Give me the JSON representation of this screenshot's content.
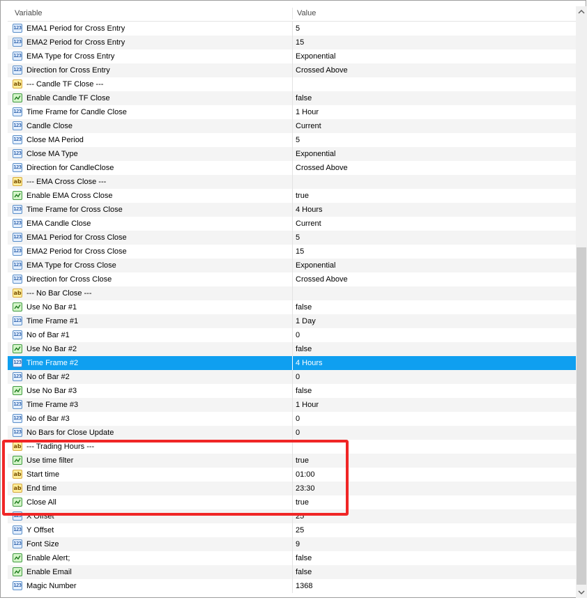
{
  "header": {
    "variable": "Variable",
    "value": "Value"
  },
  "rows": [
    {
      "type": "int",
      "name": "EMA1 Period for Cross Entry",
      "value": "5"
    },
    {
      "type": "int",
      "name": "EMA2 Period for Cross Entry",
      "value": "15"
    },
    {
      "type": "int",
      "name": "EMA Type for Cross Entry",
      "value": "Exponential"
    },
    {
      "type": "int",
      "name": "Direction for Cross Entry",
      "value": "Crossed Above"
    },
    {
      "type": "str",
      "name": "--- Candle TF Close ---",
      "value": ""
    },
    {
      "type": "bool",
      "name": "Enable Candle TF Close",
      "value": "false"
    },
    {
      "type": "int",
      "name": "Time Frame for Candle Close",
      "value": "1 Hour"
    },
    {
      "type": "int",
      "name": "Candle Close",
      "value": "Current"
    },
    {
      "type": "int",
      "name": "Close MA Period",
      "value": "5"
    },
    {
      "type": "int",
      "name": "Close MA Type",
      "value": "Exponential"
    },
    {
      "type": "int",
      "name": "Direction for CandleClose",
      "value": "Crossed Above"
    },
    {
      "type": "str",
      "name": "--- EMA Cross Close ---",
      "value": ""
    },
    {
      "type": "bool",
      "name": "Enable EMA Cross Close",
      "value": "true"
    },
    {
      "type": "int",
      "name": "Time Frame for Cross Close",
      "value": "4 Hours"
    },
    {
      "type": "int",
      "name": "EMA Candle Close",
      "value": "Current"
    },
    {
      "type": "int",
      "name": "EMA1 Period for Cross Close",
      "value": "5"
    },
    {
      "type": "int",
      "name": "EMA2 Period for Cross Close",
      "value": "15"
    },
    {
      "type": "int",
      "name": "EMA Type for Cross Close",
      "value": "Exponential"
    },
    {
      "type": "int",
      "name": "Direction for Cross Close",
      "value": "Crossed Above"
    },
    {
      "type": "str",
      "name": "--- No Bar Close ---",
      "value": ""
    },
    {
      "type": "bool",
      "name": "Use No Bar #1",
      "value": "false"
    },
    {
      "type": "int",
      "name": "Time Frame #1",
      "value": "1 Day"
    },
    {
      "type": "int",
      "name": "No of Bar #1",
      "value": "0"
    },
    {
      "type": "bool",
      "name": "Use No Bar #2",
      "value": "false"
    },
    {
      "type": "int",
      "name": "Time Frame #2",
      "value": "4 Hours",
      "selected": true
    },
    {
      "type": "int",
      "name": "No of Bar #2",
      "value": "0"
    },
    {
      "type": "bool",
      "name": "Use No Bar #3",
      "value": "false"
    },
    {
      "type": "int",
      "name": "Time Frame #3",
      "value": "1 Hour"
    },
    {
      "type": "int",
      "name": "No of Bar #3",
      "value": "0"
    },
    {
      "type": "int",
      "name": "No Bars for Close Update",
      "value": "0"
    },
    {
      "type": "str",
      "name": "--- Trading Hours ---",
      "value": ""
    },
    {
      "type": "bool",
      "name": "Use time filter",
      "value": "true"
    },
    {
      "type": "str",
      "name": "Start time",
      "value": "01:00"
    },
    {
      "type": "str",
      "name": "End time",
      "value": "23:30"
    },
    {
      "type": "bool",
      "name": "Close All",
      "value": "true"
    },
    {
      "type": "int",
      "name": "X Offset",
      "value": "25"
    },
    {
      "type": "int",
      "name": "Y Offset",
      "value": "25"
    },
    {
      "type": "int",
      "name": "Font Size",
      "value": "9"
    },
    {
      "type": "bool",
      "name": "Enable Alert;",
      "value": "false"
    },
    {
      "type": "bool",
      "name": "Enable Email",
      "value": "false"
    },
    {
      "type": "int",
      "name": "Magic Number",
      "value": "1368"
    }
  ],
  "icons": {
    "int": "integer-type-icon",
    "str": "string-type-icon",
    "bool": "boolean-type-icon"
  },
  "icon_text": {
    "int": "123",
    "str": "ab"
  },
  "scrollbar": {
    "up": "▲",
    "down": "▼"
  },
  "colors": {
    "selection": "#0f9ff0",
    "highlight": "#f02626",
    "alt_row": "#f4f4f4"
  }
}
